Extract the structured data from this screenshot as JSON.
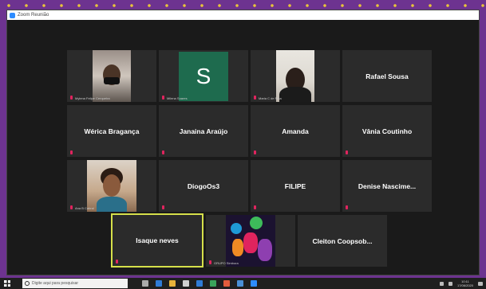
{
  "window": {
    "title": "Zoom Reunião"
  },
  "participants": [
    {
      "name": "",
      "label": "Mylena Felipe Cerqueira",
      "kind": "camera"
    },
    {
      "name": "",
      "label": "Milena Soares",
      "kind": "avatar",
      "avatar_letter": "S",
      "avatar_color": "#1e6b4e"
    },
    {
      "name": "",
      "label": "Maria C de Pina",
      "kind": "camera"
    },
    {
      "name": "Rafael Sousa",
      "label": "",
      "kind": "name"
    },
    {
      "name": "Wérica Bragança",
      "label": "",
      "kind": "name"
    },
    {
      "name": "Janaina Araújo",
      "label": "",
      "kind": "name"
    },
    {
      "name": "Amanda",
      "label": "",
      "kind": "name"
    },
    {
      "name": "Vânia Coutinho",
      "label": "",
      "kind": "name"
    },
    {
      "name": "",
      "label": "Ana B Cabral",
      "kind": "camera"
    },
    {
      "name": "DiogoOs3",
      "label": "",
      "kind": "name"
    },
    {
      "name": "FILIPE",
      "label": "",
      "kind": "name"
    },
    {
      "name": "Denise Nascime...",
      "label": "",
      "kind": "name"
    },
    {
      "name": "Isaque neves",
      "label": "",
      "kind": "name",
      "active_speaker": true
    },
    {
      "name": "",
      "label": "GRUPO Simbora",
      "kind": "logo"
    },
    {
      "name": "Cleiton Coopsob...",
      "label": "",
      "kind": "name"
    }
  ],
  "taskbar": {
    "search_placeholder": "Digite aqui para pesquisar",
    "time": "10:11",
    "date": "17/06/2020"
  },
  "colors": {
    "desktop": "#6d3390",
    "tile_bg": "#2b2b2b",
    "active_border": "#d6e04a",
    "muted_mic": "#e0245e"
  }
}
